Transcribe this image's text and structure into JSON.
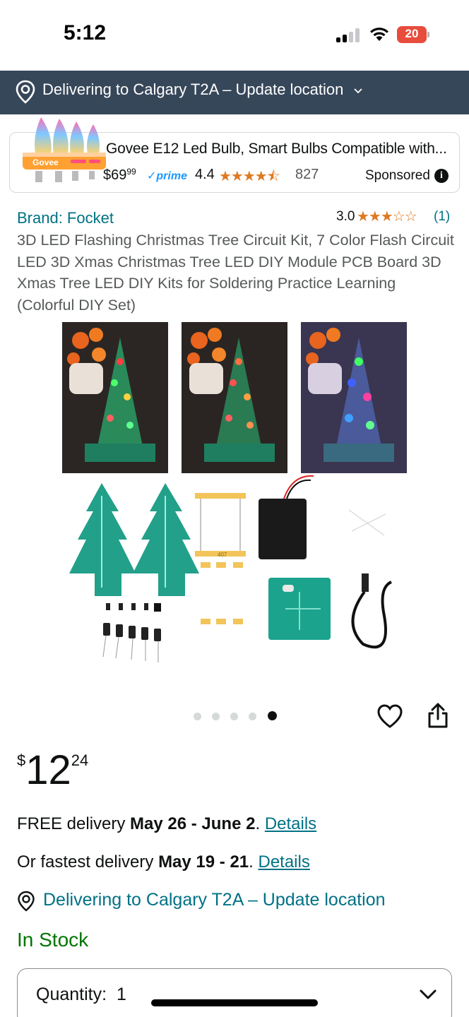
{
  "status_bar": {
    "time": "5:12",
    "battery": "20"
  },
  "location_banner": {
    "text": "Delivering to Calgary T2A – Update location"
  },
  "sponsored_ad": {
    "title": "Govee E12 Led Bulb, Smart Bulbs Compatible with...",
    "price_whole": "$69",
    "price_fraction": "99",
    "prime": "✓prime",
    "rating": "4.4",
    "stars": "★★★★⯪",
    "review_count": "827",
    "sponsored_label": "Sponsored",
    "brand_on_box": "Govee"
  },
  "product": {
    "brand_link": "Brand: Focket",
    "rating": "3.0",
    "stars": "★★★☆☆",
    "review_count": "(1)",
    "title": "3D LED Flashing Christmas Tree Circuit Kit, 7 Color Flash Circuit LED 3D Xmas Christmas Tree LED DIY Module PCB Board 3D Xmas Tree LED DIY Kits for Soldering Practice Learning (Colorful DIY Set)",
    "image_label": "407"
  },
  "carousel": {
    "total": 5,
    "active_index": 5
  },
  "price": {
    "symbol": "$",
    "whole": "12",
    "fraction": "24"
  },
  "delivery": {
    "free_prefix": "FREE delivery ",
    "free_dates": "May 26 - June 2",
    "free_suffix": ". ",
    "fast_prefix": "Or fastest delivery ",
    "fast_dates": "May 19 - 21",
    "fast_suffix": ". ",
    "details_label": "Details",
    "location_text": "Delivering to Calgary T2A – Update location"
  },
  "stock_status": "In Stock",
  "quantity": {
    "label": "Quantity:",
    "value": "1"
  },
  "colors": {
    "banner_bg": "#37475a",
    "link": "#007185",
    "in_stock": "#007600",
    "star": "#de7921",
    "prime": "#1a98ff"
  },
  "icons": [
    "location-pin-icon",
    "chevron-down-icon",
    "info-icon",
    "heart-icon",
    "share-icon",
    "signal-icon",
    "wifi-icon",
    "battery-icon"
  ]
}
